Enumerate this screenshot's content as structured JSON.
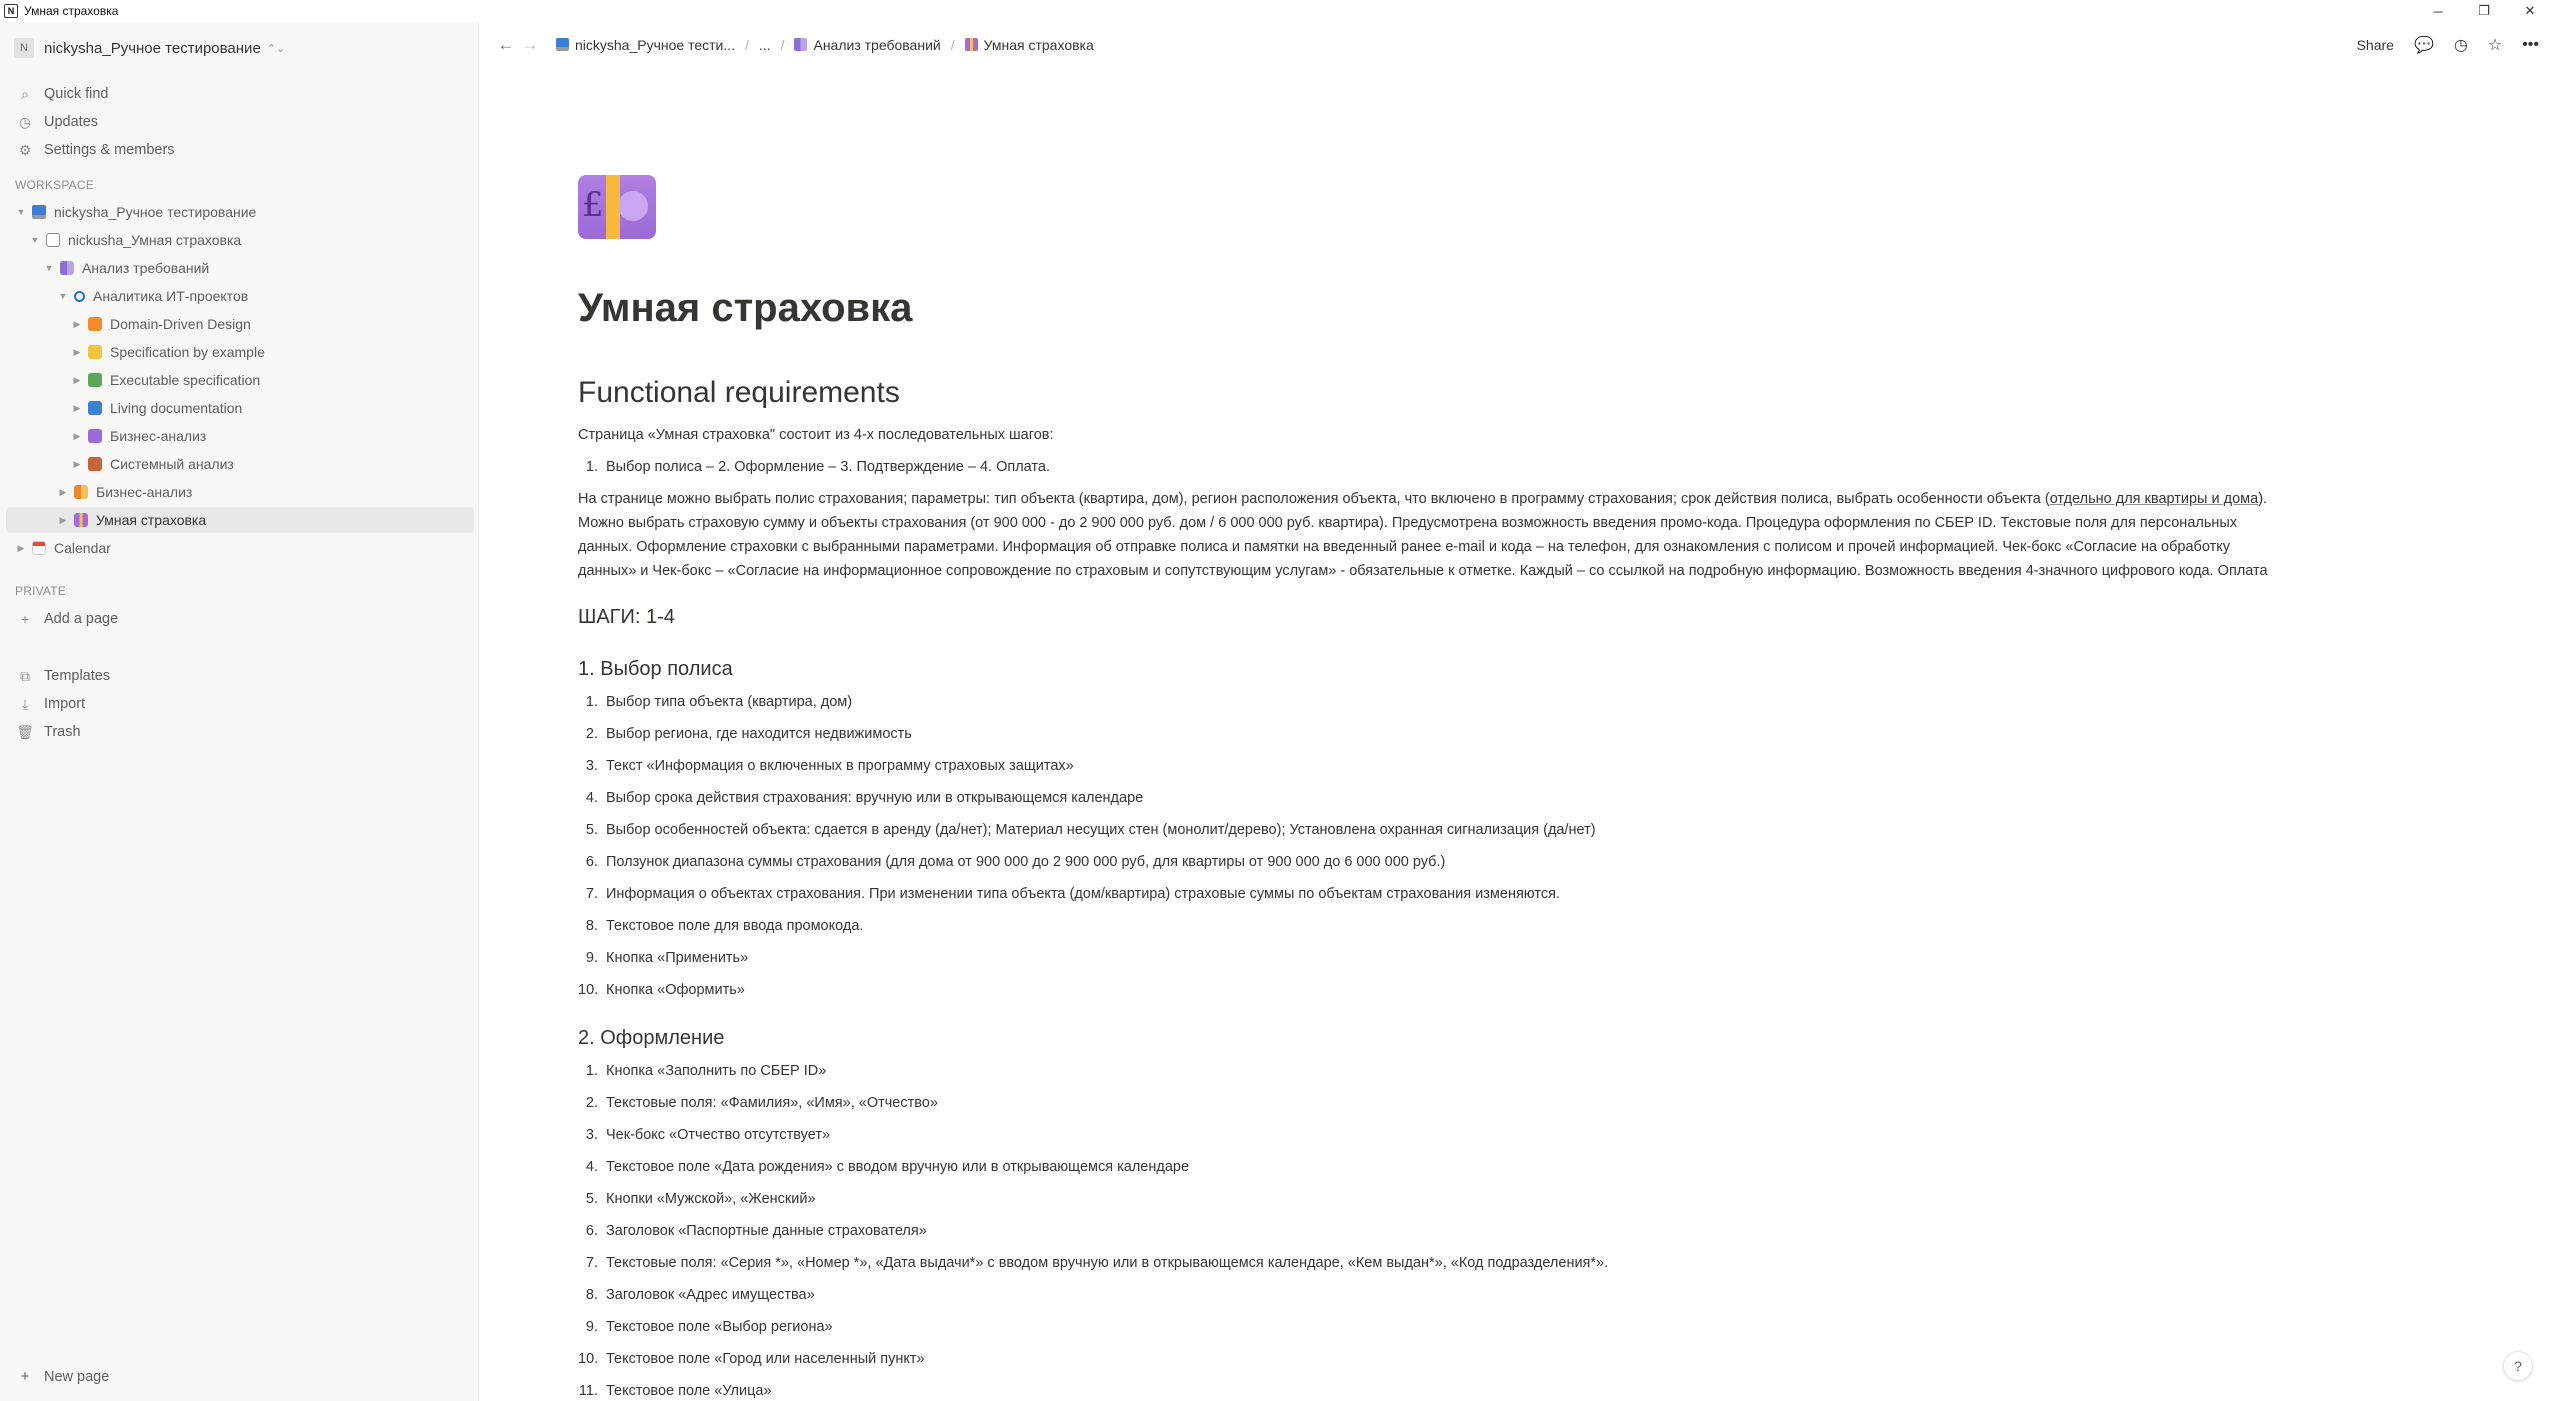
{
  "window": {
    "title": "Умная страховка"
  },
  "sidebar": {
    "workspace_name": "nickysha_Ручное тестирование",
    "workspace_initial": "N",
    "top_items": [
      {
        "label": "Quick find",
        "icon": "search-icon"
      },
      {
        "label": "Updates",
        "icon": "clock-icon"
      },
      {
        "label": "Settings & members",
        "icon": "gear-icon"
      }
    ],
    "workspace_header": "WORKSPACE",
    "tree": [
      {
        "label": "nickysha_Ручное тестирование",
        "icon": "computer-icon",
        "toggle": "▼",
        "level": 0
      },
      {
        "label": "nickusha_Умная страховка",
        "icon": "document-icon",
        "toggle": "▼",
        "level": 1
      },
      {
        "label": "Анализ требований",
        "icon": "book-icon",
        "toggle": "▼",
        "level": 2
      },
      {
        "label": "Аналитика ИТ-проектов",
        "icon": "magnifier-icon",
        "toggle": "▼",
        "level": 3
      },
      {
        "label": "Domain-Driven Design",
        "icon": "orange-square-icon",
        "toggle": "▶",
        "level": 4,
        "color": "#f28c28"
      },
      {
        "label": "Specification by example",
        "icon": "yellow-square-icon",
        "toggle": "▶",
        "level": 4,
        "color": "#f5c542"
      },
      {
        "label": "Executable specification",
        "icon": "green-square-icon",
        "toggle": "▶",
        "level": 4,
        "color": "#5aa55a"
      },
      {
        "label": "Living documentation",
        "icon": "blue-square-icon",
        "toggle": "▶",
        "level": 4,
        "color": "#3b82d6"
      },
      {
        "label": "Бизнес-анализ",
        "icon": "purple-square-icon",
        "toggle": "▶",
        "level": 4,
        "color": "#9b6ad6"
      },
      {
        "label": "Системный анализ",
        "icon": "brown-square-icon",
        "toggle": "▶",
        "level": 4,
        "color": "#c8643c"
      },
      {
        "label": "Бизнес-анализ",
        "icon": "bills-icon",
        "toggle": "▶",
        "level": 3
      },
      {
        "label": "Умная страховка",
        "icon": "money-icon",
        "toggle": "▶",
        "level": 3,
        "selected": true
      },
      {
        "label": "Calendar",
        "icon": "calendar-icon",
        "toggle": "▶",
        "level": 0
      }
    ],
    "private_header": "PRIVATE",
    "add_page": "Add a page",
    "bottom_items": [
      {
        "label": "Templates",
        "icon": "templates-icon"
      },
      {
        "label": "Import",
        "icon": "import-icon"
      },
      {
        "label": "Trash",
        "icon": "trash-icon"
      }
    ],
    "new_page": "New page"
  },
  "topbar": {
    "breadcrumbs": [
      "nickysha_Ручное тести...",
      "...",
      "Анализ требований",
      "Умная страховка"
    ],
    "share": "Share"
  },
  "page": {
    "title": "Умная страховка",
    "h_functional": "Functional requirements",
    "intro": "Страница «Умная страховка\" состоит из 4-х последовательных шагов:",
    "intro_list": [
      "Выбор полиса – 2. Оформление – 3. Подтверждение – 4. Оплата."
    ],
    "description": {
      "line1_a": "На странице можно выбрать полис страхования; параметры: тип объекта (квартира, дом), регион расположения объекта, что включено в программу страхования; срок действия полиса, выбрать особенности объекта (",
      "line1_link": "отдельно для квартиры и дома",
      "line1_b": ").",
      "line2": "Можно выбрать страховую сумму и объекты страхования (от 900 000 - до 2 900 000 руб.  дом / 6 000 000 руб. квартира). Предусмотрена возможность введения промо-кода. Процедура оформления по СБЕР ID. Текстовые поля для персональных",
      "line3": "данных. Оформление страховки с выбранными параметрами. Информация об отправке полиса и памятки на введенный ранее e-mail и кода – на телефон, для ознакомления с полисом и прочей информацией. Чек-бокс «Согласие на обработку",
      "line4": "данных» и Чек-бокс – «Согласие на информационное сопровождение по страховым и сопутствующим услугам» - обязательные к отметке. Каждый – со ссылкой на подробную информацию. Возможность введения 4-значного цифрового кода. Оплата"
    },
    "h_steps": "ШАГИ: 1-4",
    "h_step1": "1. Выбор полиса",
    "step1": [
      "Выбор типа объекта (квартира, дом)",
      "Выбор региона, где находится недвижимость",
      "Текст «Информация о включенных в программу страховых защитах»",
      "Выбор срока действия страхования: вручную или в открывающемся календаре",
      "Выбор особенностей объекта: сдается в аренду (да/нет); Материал несущих стен (монолит/дерево); Установлена охранная сигнализация (да/нет)",
      "Ползунок диапазона суммы страхования (для дома от 900 000 до 2 900 000 руб, для квартиры от 900 000 до 6 000 000 руб.)",
      "Информация о объектах страхования. При изменении типа объекта (дом/квартира) страховые суммы по объектам страхования изменяются.",
      "Текстовое поле для ввода промокода.",
      "Кнопка «Применить»",
      "Кнопка «Оформить»"
    ],
    "h_step2": "2. Оформление",
    "step2": [
      "Кнопка «Заполнить по СБЕР ID»",
      "Текстовые поля: «Фамилия», «Имя», «Отчество»",
      "Чек-бокс «Отчество отсутствует»",
      "Текстовое поле «Дата рождения» с вводом вручную или в открывающемся календаре",
      "Кнопки «Мужской», «Женский»",
      "Заголовок «Паспортные данные страхователя»",
      "Текстовые поля: «Серия *», «Номер *», «Дата выдачи*» с вводом вручную или в открывающемся календаре, «Кем выдан*», «Код подразделения*».",
      "Заголовок «Адрес имущества»",
      "Текстовое поле «Выбор региона»",
      "Текстовое поле «Город или населенный пункт»",
      "Текстовое поле «Улица»"
    ]
  }
}
